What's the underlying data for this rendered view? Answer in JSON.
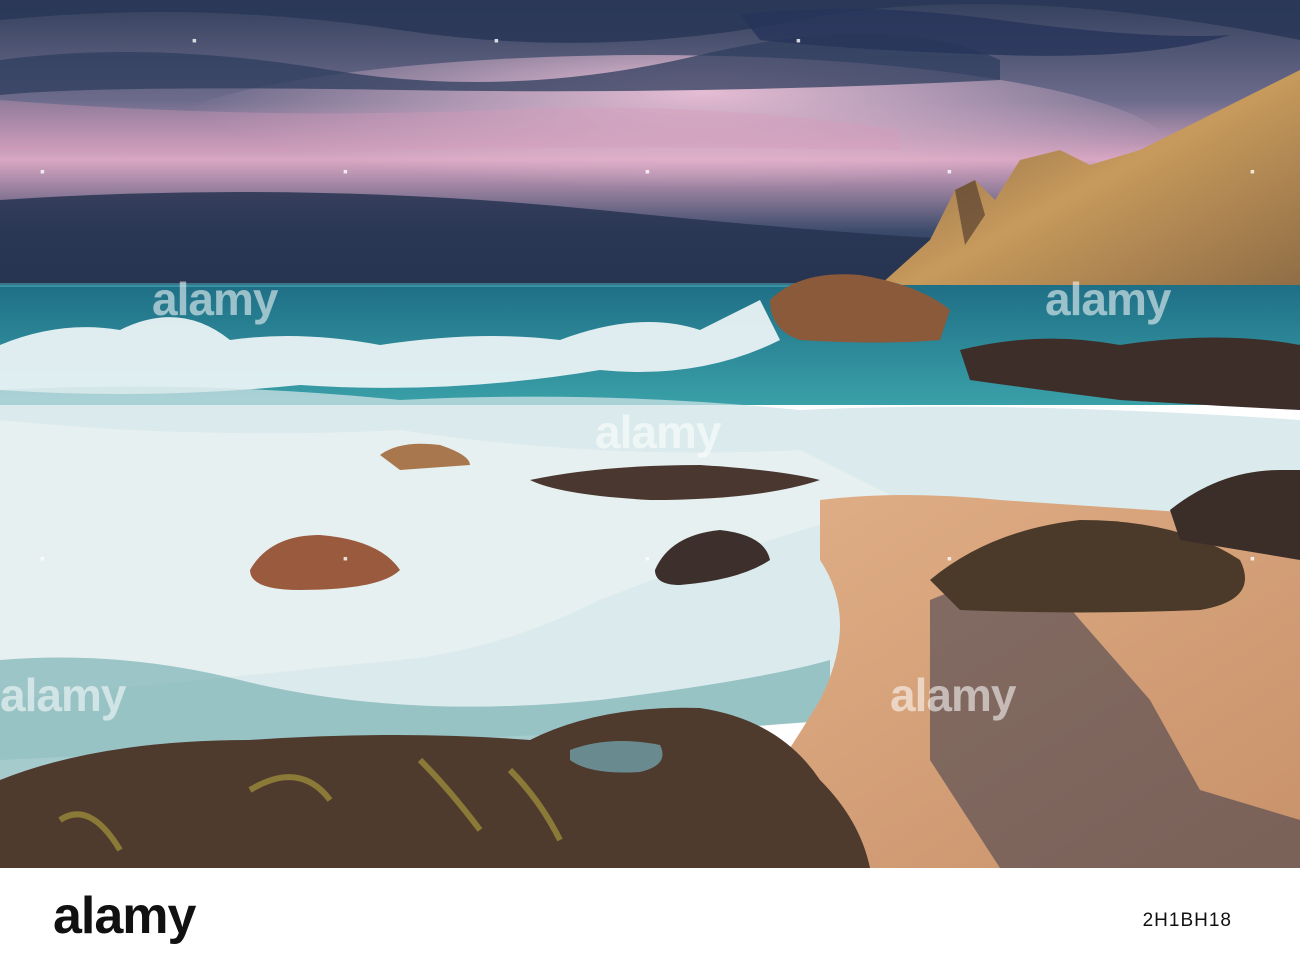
{
  "image": {
    "subject": "coastal",
    "palette": {
      "sky_top": "#2b3a55",
      "cloud_pink": "#e9b6cf",
      "storm": "#26324b",
      "sea": "#2e8a95",
      "foam": "#f2f4f5",
      "sand": "#d7a679",
      "rock": "#5a3a2a",
      "mountain": "#b8894e"
    }
  },
  "watermark": {
    "text": "alamy"
  },
  "footer": {
    "brand": "alamy",
    "stock_id": "2H1BH18"
  }
}
